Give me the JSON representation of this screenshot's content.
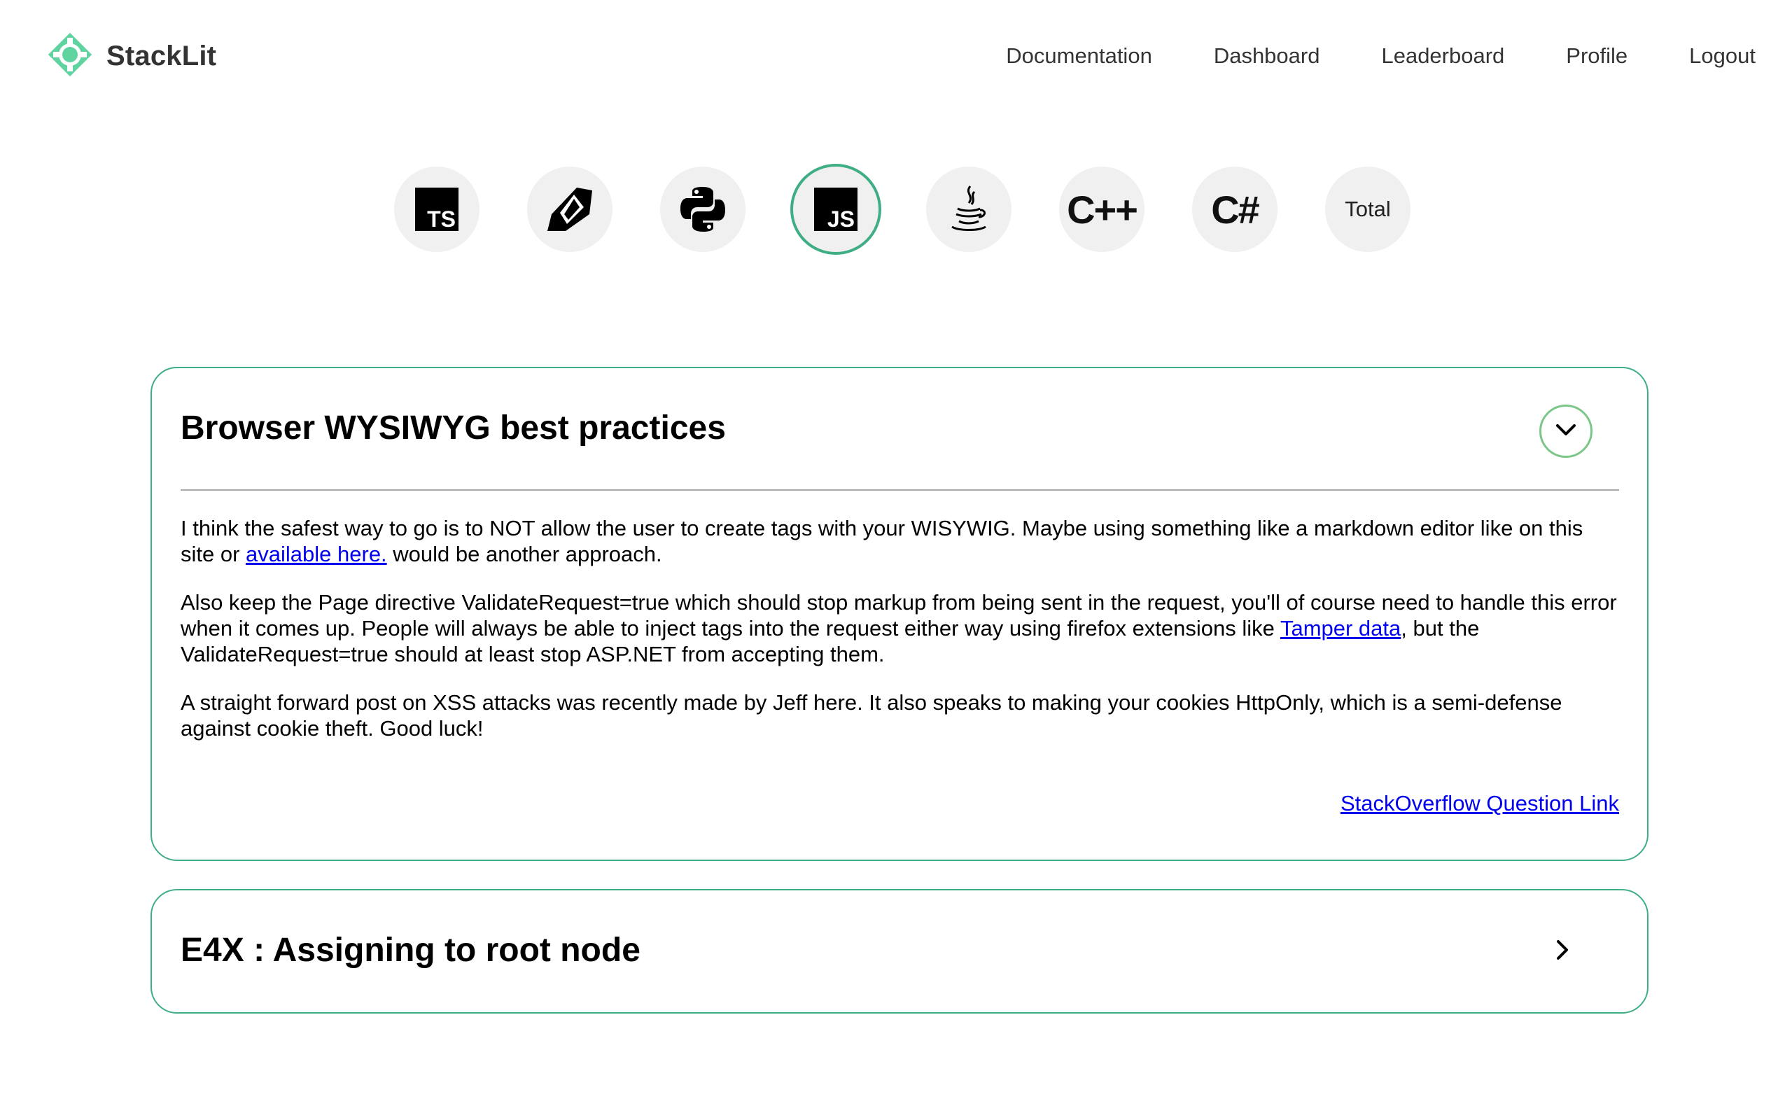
{
  "app": {
    "brand": "StackLit",
    "brand_color": "#5fd4a0",
    "accent": "#3fae84"
  },
  "nav": {
    "items": [
      "Documentation",
      "Dashboard",
      "Leaderboard",
      "Profile",
      "Logout"
    ]
  },
  "languages": {
    "items": [
      {
        "icon": "typescript-icon",
        "label": "TS"
      },
      {
        "icon": "ruby-icon",
        "label": ""
      },
      {
        "icon": "python-icon",
        "label": ""
      },
      {
        "icon": "javascript-icon",
        "label": "JS",
        "selected": true
      },
      {
        "icon": "java-icon",
        "label": ""
      },
      {
        "icon": "cpp-icon",
        "label": "C++"
      },
      {
        "icon": "csharp-icon",
        "label": "C#"
      },
      {
        "icon": "total",
        "label": "Total"
      }
    ]
  },
  "cards": [
    {
      "title": "Browser WYSIWYG best practices",
      "expanded": true,
      "p1_a": "I think the safest way to go is to NOT allow the user to create tags with your WISYWIG. Maybe using something like a markdown editor like on this site or ",
      "p1_link": "available here.",
      "p1_b": " would be another approach.",
      "p2_a": "Also keep the Page directive ValidateRequest=true which should stop markup from being sent in the request, you'll of course need to handle this error when it comes up. People will always be able to inject tags into the request either way using firefox extensions like ",
      "p2_link": "Tamper data",
      "p2_b": ", but the ValidateRequest=true should at least stop ASP.NET from accepting them.",
      "p3": "A straight forward post on XSS attacks was recently made by Jeff here. It also speaks to making your cookies HttpOnly, which is a semi-defense against cookie theft. Good luck!",
      "question_link": "StackOverflow Question Link"
    },
    {
      "title": "E4X : Assigning to root node",
      "expanded": false
    }
  ]
}
